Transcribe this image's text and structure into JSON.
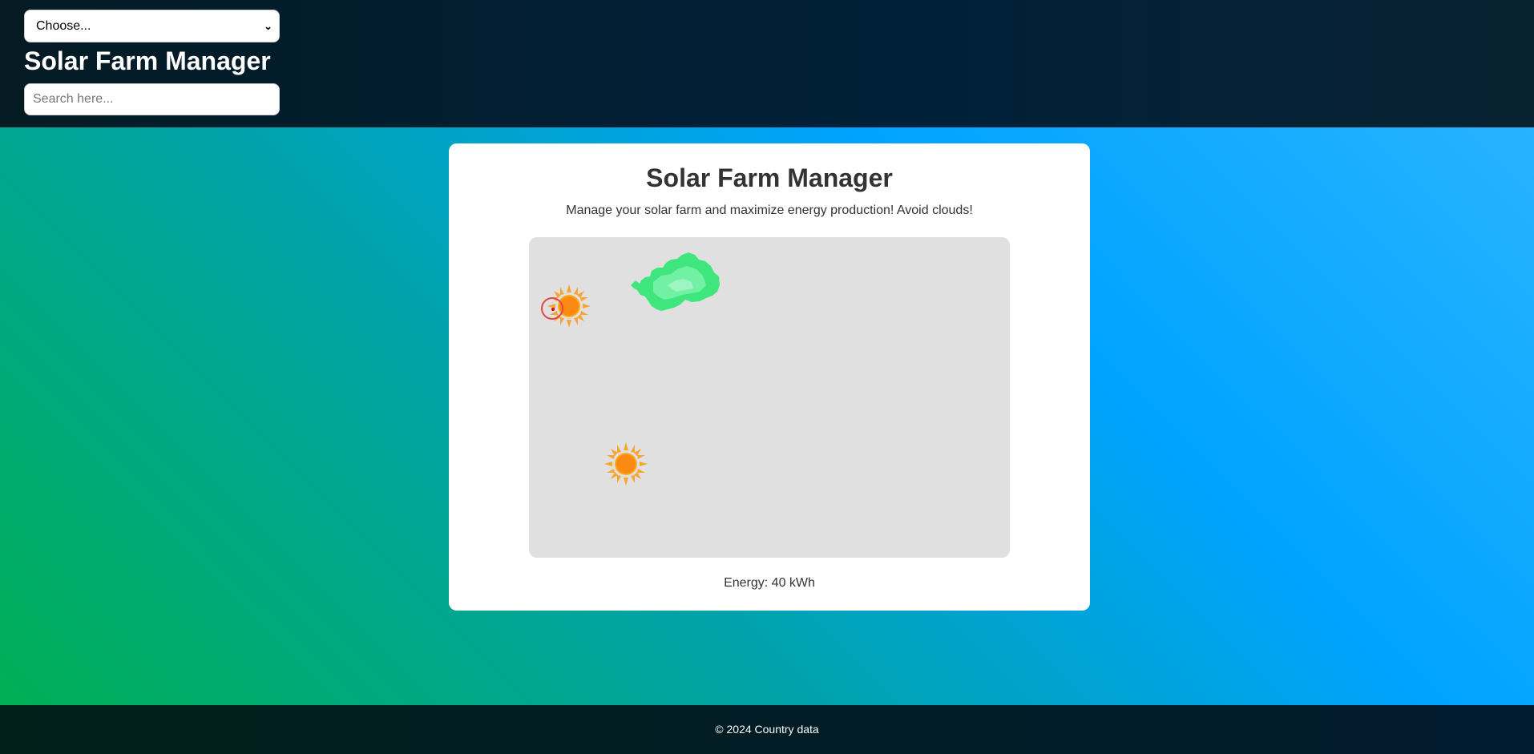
{
  "header": {
    "select_value": "Choose...",
    "title": "Solar Farm Manager",
    "search_placeholder": "Search here..."
  },
  "game": {
    "title": "Solar Farm Manager",
    "description": "Manage your solar farm and maximize energy production! Avoid clouds!",
    "energy_text": "Energy: 40 kWh",
    "board_color": "#e0e0e0",
    "sprites": [
      "sun-icon",
      "sun-icon",
      "cloud-icon",
      "player-cursor"
    ]
  },
  "footer": {
    "text": "© 2024 Country data"
  }
}
